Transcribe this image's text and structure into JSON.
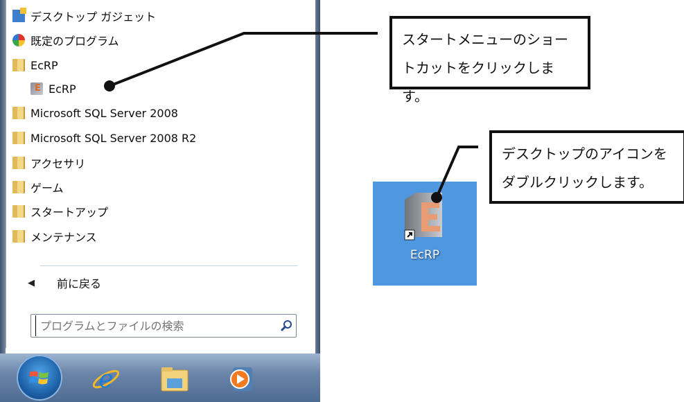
{
  "start_menu": {
    "items": [
      {
        "label": "デスクトップ ガジェット",
        "icon": "desktop-gadget-icon"
      },
      {
        "label": "既定のプログラム",
        "icon": "default-programs-icon"
      },
      {
        "label": "EcRP",
        "icon": "folder-icon"
      },
      {
        "label": "EcRP",
        "icon": "ecrp-app-icon"
      },
      {
        "label": "Microsoft SQL Server 2008",
        "icon": "folder-icon"
      },
      {
        "label": "Microsoft SQL Server 2008 R2",
        "icon": "folder-icon"
      },
      {
        "label": "アクセサリ",
        "icon": "folder-icon"
      },
      {
        "label": "ゲーム",
        "icon": "folder-icon"
      },
      {
        "label": "スタートアップ",
        "icon": "folder-icon"
      },
      {
        "label": "メンテナンス",
        "icon": "folder-icon"
      }
    ],
    "back_label": "前に戻る",
    "search_placeholder": "プログラムとファイルの検索"
  },
  "taskbar": {
    "icons": [
      "start-orb-icon",
      "internet-explorer-icon",
      "windows-explorer-icon",
      "media-player-icon"
    ]
  },
  "callouts": {
    "start_menu_line1": "スタートメニューのショー",
    "start_menu_line2": "トカットをクリックします。",
    "desktop_line1": "デスクトップのアイコンを",
    "desktop_line2": "ダブルクリックします。"
  },
  "desktop": {
    "icon_label": "EcRP"
  },
  "colors": {
    "desktop_bg": "#4f97df",
    "callout_border": "#111111",
    "ecrp_accent": "#e4682a"
  }
}
